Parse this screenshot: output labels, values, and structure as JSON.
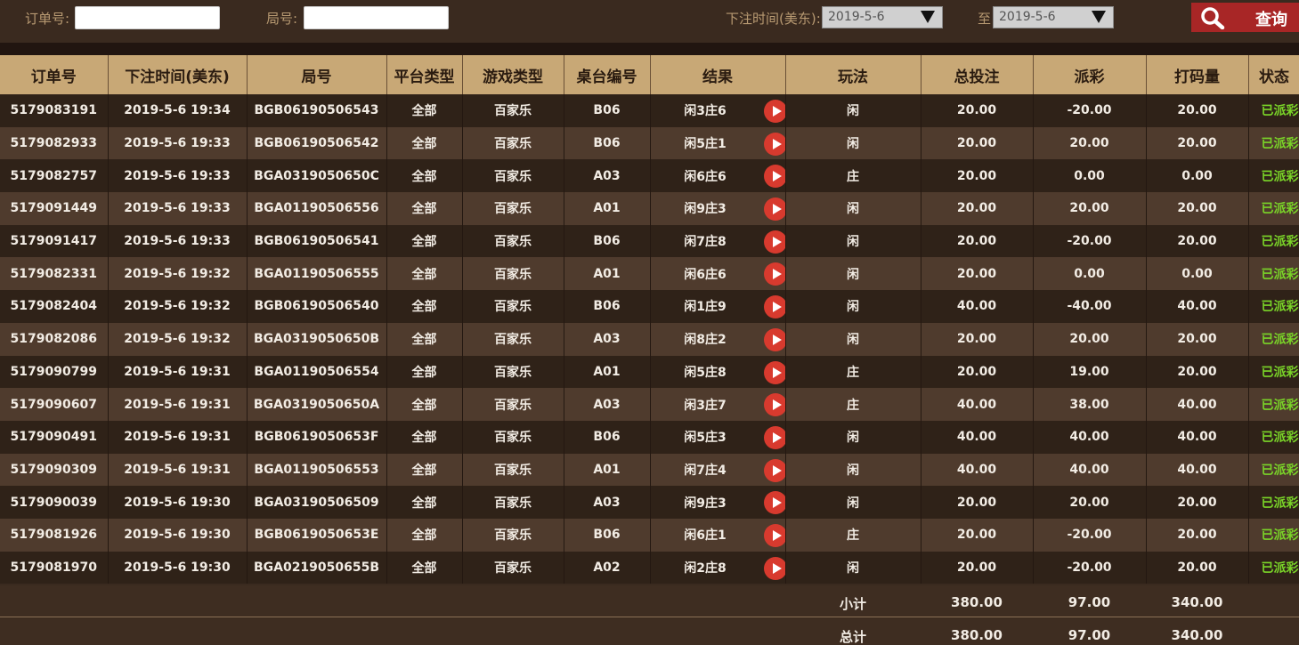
{
  "filters": {
    "order_label": "订单号:",
    "order_value": "",
    "round_label": "局号:",
    "round_value": "",
    "time_label": "下注时间(美东):",
    "start_date": "2019-5-6",
    "to_label": "至",
    "end_date": "2019-5-6",
    "query_label": "查询"
  },
  "table": {
    "columns": [
      "订单号",
      "下注时间(美东)",
      "局号",
      "平台类型",
      "游戏类型",
      "桌台编号",
      "结果",
      "玩法",
      "总投注",
      "派彩",
      "打码量",
      "状态"
    ],
    "rows": [
      {
        "order": "5179083191",
        "time": "2019-5-6 19:34",
        "round": "BGB06190506543",
        "platform": "全部",
        "game": "百家乐",
        "table": "B06",
        "result": "闲3庄6",
        "play": "闲",
        "bet": "20.00",
        "payout": "-20.00",
        "turnover": "20.00",
        "status": "已派彩"
      },
      {
        "order": "5179082933",
        "time": "2019-5-6 19:33",
        "round": "BGB06190506542",
        "platform": "全部",
        "game": "百家乐",
        "table": "B06",
        "result": "闲5庄1",
        "play": "闲",
        "bet": "20.00",
        "payout": "20.00",
        "turnover": "20.00",
        "status": "已派彩"
      },
      {
        "order": "5179082757",
        "time": "2019-5-6 19:33",
        "round": "BGA0319050650C",
        "platform": "全部",
        "game": "百家乐",
        "table": "A03",
        "result": "闲6庄6",
        "play": "庄",
        "bet": "20.00",
        "payout": "0.00",
        "turnover": "0.00",
        "status": "已派彩"
      },
      {
        "order": "5179091449",
        "time": "2019-5-6 19:33",
        "round": "BGA01190506556",
        "platform": "全部",
        "game": "百家乐",
        "table": "A01",
        "result": "闲9庄3",
        "play": "闲",
        "bet": "20.00",
        "payout": "20.00",
        "turnover": "20.00",
        "status": "已派彩"
      },
      {
        "order": "5179091417",
        "time": "2019-5-6 19:33",
        "round": "BGB06190506541",
        "platform": "全部",
        "game": "百家乐",
        "table": "B06",
        "result": "闲7庄8",
        "play": "闲",
        "bet": "20.00",
        "payout": "-20.00",
        "turnover": "20.00",
        "status": "已派彩"
      },
      {
        "order": "5179082331",
        "time": "2019-5-6 19:32",
        "round": "BGA01190506555",
        "platform": "全部",
        "game": "百家乐",
        "table": "A01",
        "result": "闲6庄6",
        "play": "闲",
        "bet": "20.00",
        "payout": "0.00",
        "turnover": "0.00",
        "status": "已派彩"
      },
      {
        "order": "5179082404",
        "time": "2019-5-6 19:32",
        "round": "BGB06190506540",
        "platform": "全部",
        "game": "百家乐",
        "table": "B06",
        "result": "闲1庄9",
        "play": "闲",
        "bet": "40.00",
        "payout": "-40.00",
        "turnover": "40.00",
        "status": "已派彩"
      },
      {
        "order": "5179082086",
        "time": "2019-5-6 19:32",
        "round": "BGA0319050650B",
        "platform": "全部",
        "game": "百家乐",
        "table": "A03",
        "result": "闲8庄2",
        "play": "闲",
        "bet": "20.00",
        "payout": "20.00",
        "turnover": "20.00",
        "status": "已派彩"
      },
      {
        "order": "5179090799",
        "time": "2019-5-6 19:31",
        "round": "BGA01190506554",
        "platform": "全部",
        "game": "百家乐",
        "table": "A01",
        "result": "闲5庄8",
        "play": "庄",
        "bet": "20.00",
        "payout": "19.00",
        "turnover": "20.00",
        "status": "已派彩"
      },
      {
        "order": "5179090607",
        "time": "2019-5-6 19:31",
        "round": "BGA0319050650A",
        "platform": "全部",
        "game": "百家乐",
        "table": "A03",
        "result": "闲3庄7",
        "play": "庄",
        "bet": "40.00",
        "payout": "38.00",
        "turnover": "40.00",
        "status": "已派彩"
      },
      {
        "order": "5179090491",
        "time": "2019-5-6 19:31",
        "round": "BGB0619050653F",
        "platform": "全部",
        "game": "百家乐",
        "table": "B06",
        "result": "闲5庄3",
        "play": "闲",
        "bet": "40.00",
        "payout": "40.00",
        "turnover": "40.00",
        "status": "已派彩"
      },
      {
        "order": "5179090309",
        "time": "2019-5-6 19:31",
        "round": "BGA01190506553",
        "platform": "全部",
        "game": "百家乐",
        "table": "A01",
        "result": "闲7庄4",
        "play": "闲",
        "bet": "40.00",
        "payout": "40.00",
        "turnover": "40.00",
        "status": "已派彩"
      },
      {
        "order": "5179090039",
        "time": "2019-5-6 19:30",
        "round": "BGA03190506509",
        "platform": "全部",
        "game": "百家乐",
        "table": "A03",
        "result": "闲9庄3",
        "play": "闲",
        "bet": "20.00",
        "payout": "20.00",
        "turnover": "20.00",
        "status": "已派彩"
      },
      {
        "order": "5179081926",
        "time": "2019-5-6 19:30",
        "round": "BGB0619050653E",
        "platform": "全部",
        "game": "百家乐",
        "table": "B06",
        "result": "闲6庄1",
        "play": "庄",
        "bet": "20.00",
        "payout": "-20.00",
        "turnover": "20.00",
        "status": "已派彩"
      },
      {
        "order": "5179081970",
        "time": "2019-5-6 19:30",
        "round": "BGA0219050655B",
        "platform": "全部",
        "game": "百家乐",
        "table": "A02",
        "result": "闲2庄8",
        "play": "闲",
        "bet": "20.00",
        "payout": "-20.00",
        "turnover": "20.00",
        "status": "已派彩"
      }
    ]
  },
  "subtotal": {
    "label": "小计",
    "bet": "380.00",
    "payout": "97.00",
    "turnover": "340.00"
  },
  "total": {
    "label": "总计",
    "bet": "380.00",
    "payout": "97.00",
    "turnover": "340.00"
  },
  "colors": {
    "header_bg": "#c8a876",
    "status_green": "#7ad428",
    "play_button": "#d83a2e",
    "query_button": "#a82626"
  }
}
